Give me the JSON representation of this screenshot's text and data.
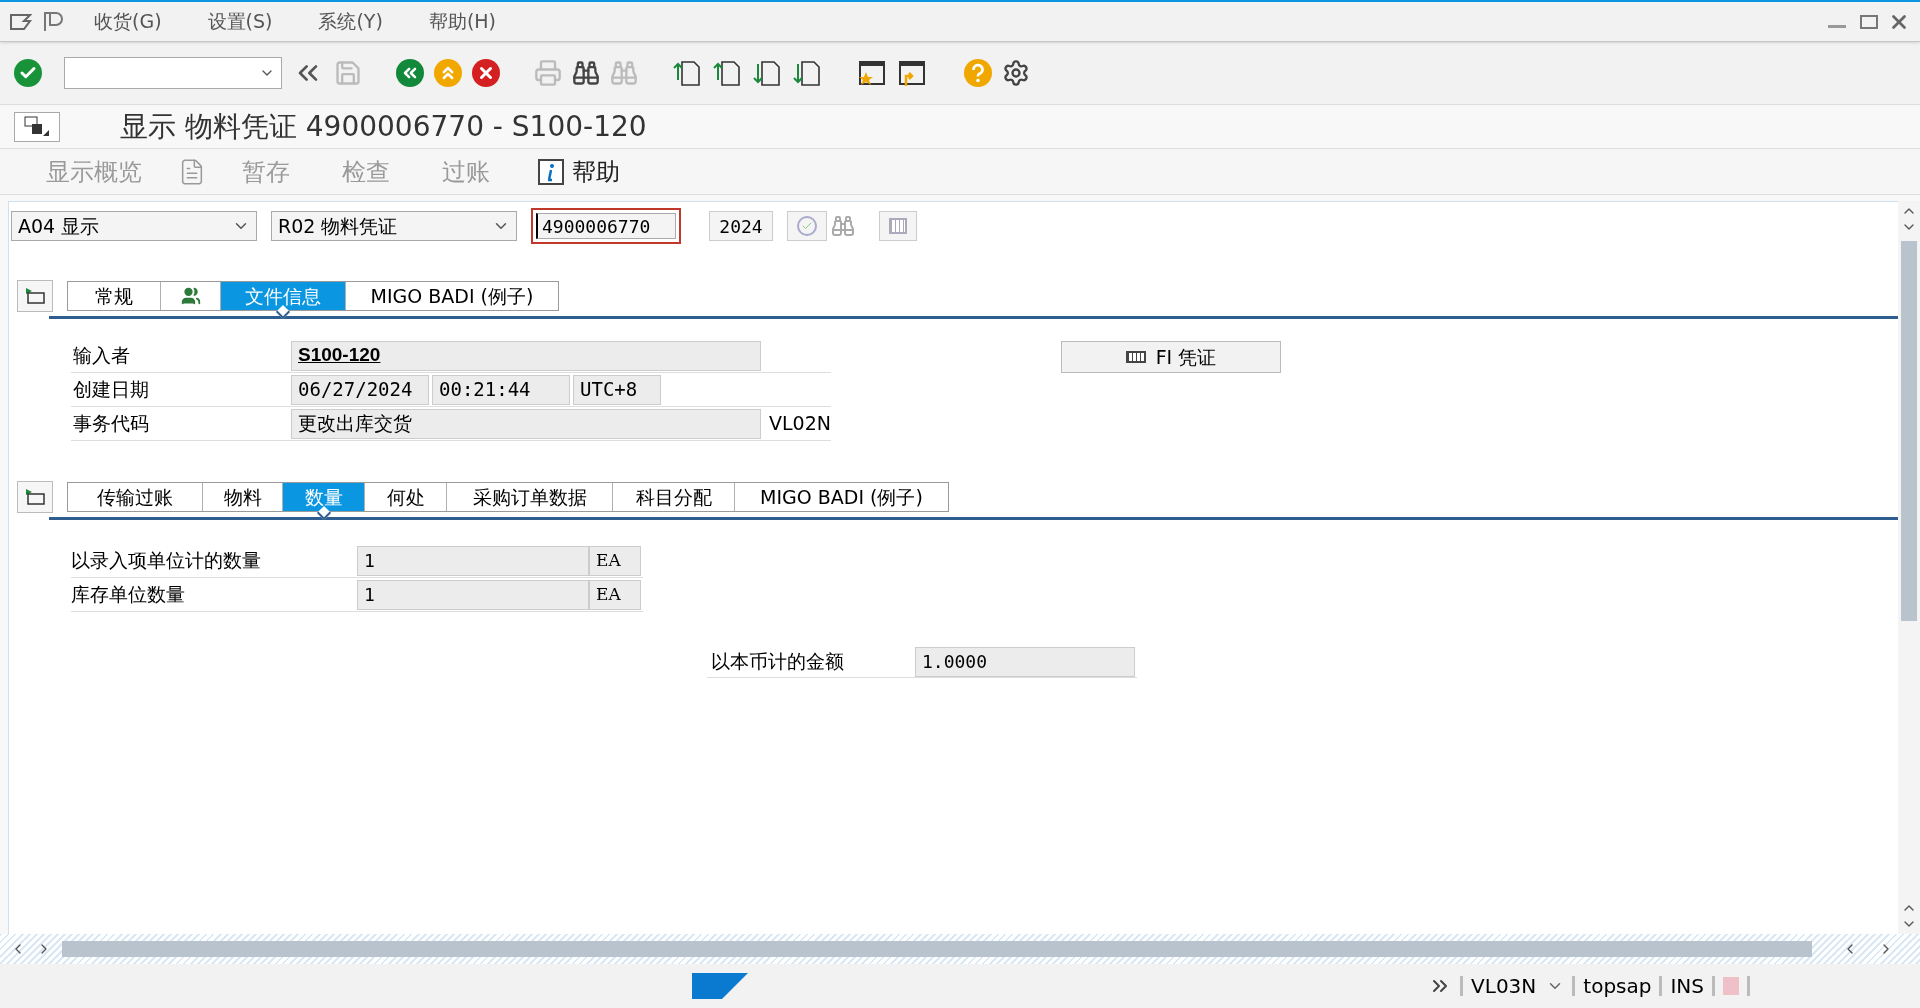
{
  "menu": [
    "收货(G)",
    "设置(S)",
    "系统(Y)",
    "帮助(H)"
  ],
  "title": "显示 物料凭证 4900006770 - S100-120",
  "app_toolbar": [
    {
      "kind": "text",
      "label": "显示概览",
      "disabled": true
    },
    {
      "kind": "icon",
      "disabled": true
    },
    {
      "kind": "text",
      "label": "暂存",
      "disabled": true
    },
    {
      "kind": "text",
      "label": "检查",
      "disabled": true
    },
    {
      "kind": "text",
      "label": "过账",
      "disabled": true
    },
    {
      "kind": "info",
      "label": "帮助",
      "disabled": false
    }
  ],
  "selection": {
    "action": "A04 显示",
    "reference": "R02 物料凭证",
    "document": "4900006770",
    "year": "2024"
  },
  "header_tabs": [
    {
      "kind": "text",
      "label": "常规",
      "selected": false
    },
    {
      "kind": "icon",
      "selected": false
    },
    {
      "kind": "text",
      "label": "文件信息",
      "selected": true
    },
    {
      "kind": "text",
      "label": "MIGO BADI (例子)",
      "selected": false
    }
  ],
  "header_fields": [
    {
      "label": "输入者",
      "values": [
        "S100-120"
      ],
      "kind": "link"
    },
    {
      "label": "创建日期",
      "values": [
        "06/27/2024",
        "00:21:44",
        "UTC+8"
      ],
      "kind": "mono"
    },
    {
      "label": "事务代码",
      "values": [
        "更改出库交货"
      ],
      "kind": "text",
      "suffix": "VL02N"
    }
  ],
  "fi_button": "FI 凭证",
  "item_tabs": [
    {
      "label": "传输过账",
      "selected": false
    },
    {
      "label": "物料",
      "selected": false
    },
    {
      "label": "数量",
      "selected": true
    },
    {
      "label": "何处",
      "selected": false
    },
    {
      "label": "采购订单数据",
      "selected": false
    },
    {
      "label": "科目分配",
      "selected": false
    },
    {
      "label": "MIGO BADI (例子)",
      "selected": false
    }
  ],
  "item_fields": [
    {
      "label": "以录入项单位计的数量",
      "value": "1",
      "unit": "EA"
    },
    {
      "label": "库存单位数量",
      "value": "1",
      "unit": "EA"
    }
  ],
  "amount": {
    "label": "以本币计的金额",
    "value": "1.0000"
  },
  "status_bar": {
    "transaction": "VL03N",
    "system": "topsap",
    "mode": "INS"
  }
}
